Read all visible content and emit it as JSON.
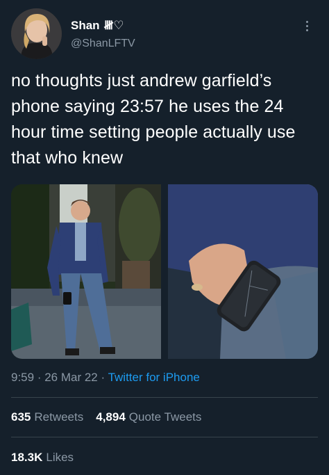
{
  "author": {
    "display_name": "Shan",
    "name_emoji": "𝍸♡",
    "handle": "@ShanLFTV"
  },
  "tweet": {
    "text": "no thoughts just andrew garfield’s phone saying 23:57 he uses the 24 hour time setting people actually use that who knew",
    "time": "9:59",
    "date": "26 Mar 22",
    "source": "Twitter for iPhone"
  },
  "stats": {
    "retweets_count": "635",
    "retweets_label": "Retweets",
    "quotes_count": "4,894",
    "quotes_label": "Quote Tweets",
    "likes_count": "18.3K",
    "likes_label": "Likes"
  },
  "icons": {
    "more": "more-vertical-icon"
  },
  "colors": {
    "background": "#15202b",
    "link": "#1d9bf0",
    "muted": "#8b98a5",
    "divider": "#38444d"
  }
}
